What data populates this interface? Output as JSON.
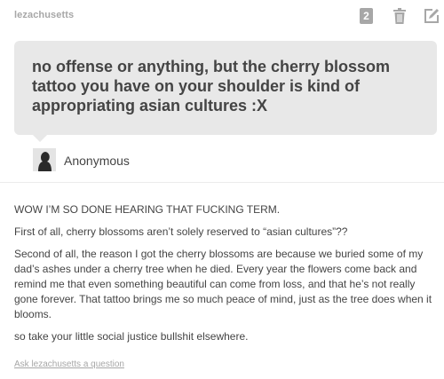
{
  "post": {
    "username": "lezachusetts",
    "note_count": "2",
    "icons": {
      "trash": "trash-icon",
      "edit": "edit-icon",
      "avatar": "anonymous-avatar-icon"
    },
    "question": "no offense or anything, but the cherry blossom tattoo you have on your shoulder is kind of appropriating asian cultures :X",
    "asker": "Anonymous",
    "answer": [
      "WOW I’M SO DONE HEARING THAT FUCKING TERM.",
      "First of all, cherry blossoms aren’t solely reserved to “asian cultures”??",
      "Second of all, the reason I got the cherry blossoms are because we buried some of my dad’s ashes under a cherry tree when he died. Every year the flowers come back and remind me that even something beautiful can come from loss, and that he’s not really gone forever. That tattoo brings me so much peace of mind, just as the tree does when it blooms.",
      "so take your little social justice bullshit elsewhere."
    ],
    "ask_link": "Ask lezachusetts a question"
  },
  "colors": {
    "question_bg": "#e8e8e8",
    "muted": "#a7a7a7",
    "text": "#444444"
  }
}
